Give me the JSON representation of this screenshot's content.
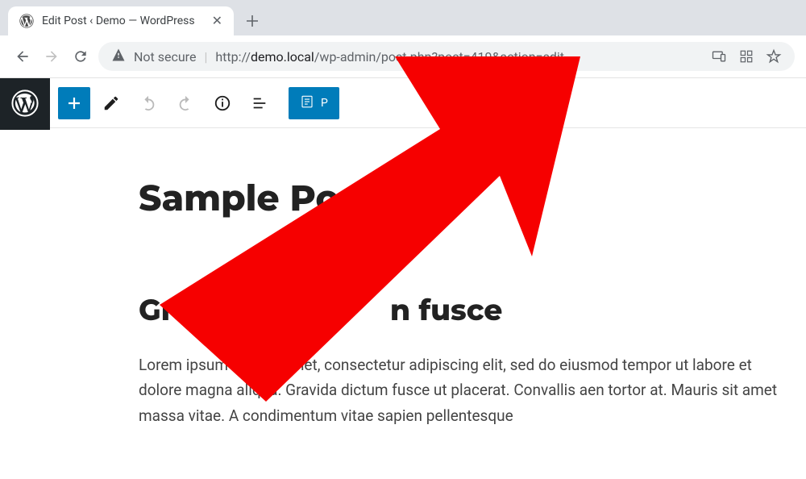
{
  "browser": {
    "tab_title": "Edit Post ‹ Demo — WordPress",
    "security_label": "Not secure",
    "url_protocol": "http://",
    "url_domain": "demo.local",
    "url_path": "/wp-admin/post.php?post=419&action=edit"
  },
  "toolbar": {
    "page_template_label": "P"
  },
  "post": {
    "title": "Sample Po",
    "heading2_pre": "Gravid",
    "heading2_post": "n fusce",
    "body": "Lorem ipsum dolor s       amet, consectetur adipiscing elit, sed do eiusmod tempor       ut labore et dolore magna aliqua. Gravida dictum fusce ut placerat. Convallis aen    tortor at. Mauris sit amet massa vitae. A condimentum vitae sapien pellentesque"
  }
}
